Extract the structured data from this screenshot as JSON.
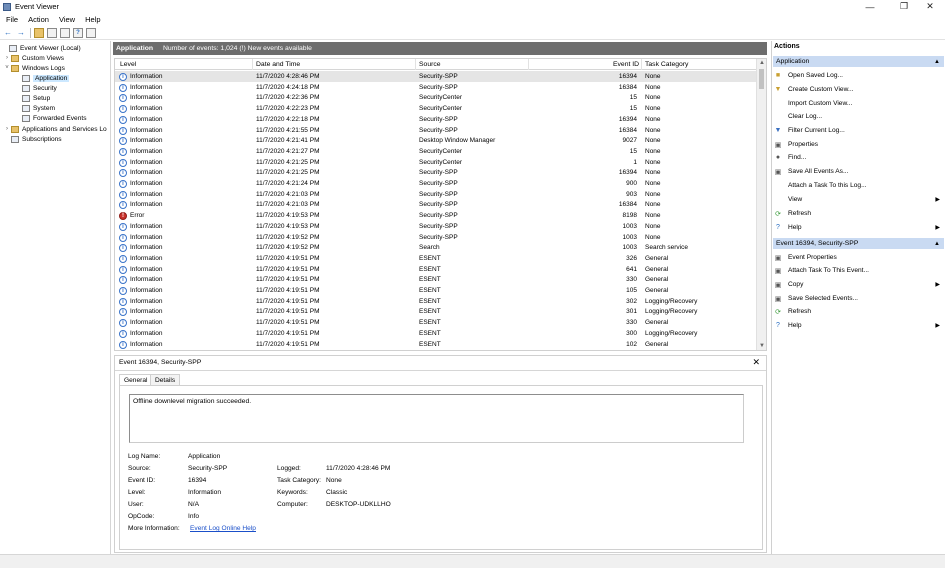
{
  "window": {
    "title": "Event Viewer"
  },
  "menu": [
    "File",
    "Action",
    "View",
    "Help"
  ],
  "tree": {
    "root": "Event Viewer (Local)",
    "custom_views": "Custom Views",
    "windows_logs": "Windows Logs",
    "application": "Application",
    "security": "Security",
    "setup": "Setup",
    "system": "System",
    "forwarded_events": "Forwarded Events",
    "apps_services": "Applications and Services Lo",
    "subscriptions": "Subscriptions"
  },
  "center": {
    "title": "Application",
    "count_text": "Number of events: 1,024 (!) New events available"
  },
  "columns": {
    "level": "Level",
    "datetime": "Date and Time",
    "source": "Source",
    "event_id": "Event ID",
    "category": "Task Category"
  },
  "events": [
    {
      "level": "Information",
      "datetime": "11/7/2020 4:28:46 PM",
      "source": "Security-SPP",
      "event_id": "16394",
      "category": "None"
    },
    {
      "level": "Information",
      "datetime": "11/7/2020 4:24:18 PM",
      "source": "Security-SPP",
      "event_id": "16384",
      "category": "None"
    },
    {
      "level": "Information",
      "datetime": "11/7/2020 4:22:36 PM",
      "source": "SecurityCenter",
      "event_id": "15",
      "category": "None"
    },
    {
      "level": "Information",
      "datetime": "11/7/2020 4:22:23 PM",
      "source": "SecurityCenter",
      "event_id": "15",
      "category": "None"
    },
    {
      "level": "Information",
      "datetime": "11/7/2020 4:22:18 PM",
      "source": "Security-SPP",
      "event_id": "16394",
      "category": "None"
    },
    {
      "level": "Information",
      "datetime": "11/7/2020 4:21:55 PM",
      "source": "Security-SPP",
      "event_id": "16384",
      "category": "None"
    },
    {
      "level": "Information",
      "datetime": "11/7/2020 4:21:41 PM",
      "source": "Desktop Window Manager",
      "event_id": "9027",
      "category": "None"
    },
    {
      "level": "Information",
      "datetime": "11/7/2020 4:21:27 PM",
      "source": "SecurityCenter",
      "event_id": "15",
      "category": "None"
    },
    {
      "level": "Information",
      "datetime": "11/7/2020 4:21:25 PM",
      "source": "SecurityCenter",
      "event_id": "1",
      "category": "None"
    },
    {
      "level": "Information",
      "datetime": "11/7/2020 4:21:25 PM",
      "source": "Security-SPP",
      "event_id": "16394",
      "category": "None"
    },
    {
      "level": "Information",
      "datetime": "11/7/2020 4:21:24 PM",
      "source": "Security-SPP",
      "event_id": "900",
      "category": "None"
    },
    {
      "level": "Information",
      "datetime": "11/7/2020 4:21:03 PM",
      "source": "Security-SPP",
      "event_id": "903",
      "category": "None"
    },
    {
      "level": "Information",
      "datetime": "11/7/2020 4:21:03 PM",
      "source": "Security-SPP",
      "event_id": "16384",
      "category": "None"
    },
    {
      "level": "Error",
      "datetime": "11/7/2020 4:19:53 PM",
      "source": "Security-SPP",
      "event_id": "8198",
      "category": "None"
    },
    {
      "level": "Information",
      "datetime": "11/7/2020 4:19:53 PM",
      "source": "Security-SPP",
      "event_id": "1003",
      "category": "None"
    },
    {
      "level": "Information",
      "datetime": "11/7/2020 4:19:52 PM",
      "source": "Security-SPP",
      "event_id": "1003",
      "category": "None"
    },
    {
      "level": "Information",
      "datetime": "11/7/2020 4:19:52 PM",
      "source": "Search",
      "event_id": "1003",
      "category": "Search service"
    },
    {
      "level": "Information",
      "datetime": "11/7/2020 4:19:51 PM",
      "source": "ESENT",
      "event_id": "326",
      "category": "General"
    },
    {
      "level": "Information",
      "datetime": "11/7/2020 4:19:51 PM",
      "source": "ESENT",
      "event_id": "641",
      "category": "General"
    },
    {
      "level": "Information",
      "datetime": "11/7/2020 4:19:51 PM",
      "source": "ESENT",
      "event_id": "330",
      "category": "General"
    },
    {
      "level": "Information",
      "datetime": "11/7/2020 4:19:51 PM",
      "source": "ESENT",
      "event_id": "105",
      "category": "General"
    },
    {
      "level": "Information",
      "datetime": "11/7/2020 4:19:51 PM",
      "source": "ESENT",
      "event_id": "302",
      "category": "Logging/Recovery"
    },
    {
      "level": "Information",
      "datetime": "11/7/2020 4:19:51 PM",
      "source": "ESENT",
      "event_id": "301",
      "category": "Logging/Recovery"
    },
    {
      "level": "Information",
      "datetime": "11/7/2020 4:19:51 PM",
      "source": "ESENT",
      "event_id": "330",
      "category": "General"
    },
    {
      "level": "Information",
      "datetime": "11/7/2020 4:19:51 PM",
      "source": "ESENT",
      "event_id": "300",
      "category": "Logging/Recovery"
    },
    {
      "level": "Information",
      "datetime": "11/7/2020 4:19:51 PM",
      "source": "ESENT",
      "event_id": "102",
      "category": "General"
    }
  ],
  "detail": {
    "title": "Event 16394, Security-SPP",
    "tab_general": "General",
    "tab_details": "Details",
    "message": "Offline downlevel migration succeeded.",
    "labels": {
      "log_name": "Log Name:",
      "source": "Source:",
      "event_id": "Event ID:",
      "level": "Level:",
      "user": "User:",
      "opcode": "OpCode:",
      "more_info": "More Information:",
      "logged": "Logged:",
      "task_category": "Task Category:",
      "keywords": "Keywords:",
      "computer": "Computer:"
    },
    "values": {
      "log_name": "Application",
      "source": "Security-SPP",
      "event_id": "16394",
      "level": "Information",
      "user": "N/A",
      "opcode": "Info",
      "more_info": "Event Log Online Help",
      "logged": "11/7/2020 4:28:46 PM",
      "task_category": "None",
      "keywords": "Classic",
      "computer": "DESKTOP-UDKLLHO"
    }
  },
  "actions": {
    "header": "Actions",
    "section1": "Application",
    "section1_items": [
      "Open Saved Log...",
      "Create Custom View...",
      "Import Custom View...",
      "Clear Log...",
      "Filter Current Log...",
      "Properties",
      "Find...",
      "Save All Events As...",
      "Attach a Task To this Log...",
      "View",
      "Refresh",
      "Help"
    ],
    "section2": "Event 16394, Security-SPP",
    "section2_items": [
      "Event Properties",
      "Attach Task To This Event...",
      "Copy",
      "Save Selected Events...",
      "Refresh",
      "Help"
    ]
  },
  "colors": {
    "header_bg": "#6d6d6d",
    "action_section_bg": "#c9daf2",
    "selection": "#cce8ff",
    "error": "#c8312b"
  }
}
